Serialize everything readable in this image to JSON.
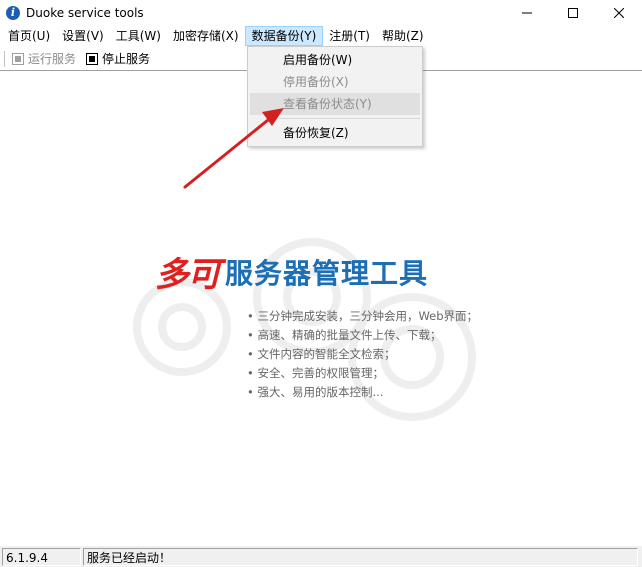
{
  "window": {
    "title": "Duoke service tools",
    "app_icon": "info-i-icon",
    "controls": [
      "minimize-icon",
      "maximize-icon",
      "close-icon"
    ]
  },
  "menubar": {
    "items": [
      {
        "label": "首页(U)"
      },
      {
        "label": "设置(V)"
      },
      {
        "label": "工具(W)"
      },
      {
        "label": "加密存储(X)"
      },
      {
        "label": "数据备份(Y)"
      },
      {
        "label": "注册(T)"
      },
      {
        "label": "帮助(Z)"
      }
    ]
  },
  "toolbar": {
    "run_label": "运行服务",
    "stop_label": "停止服务"
  },
  "dropdown": {
    "items": [
      {
        "label": "启用备份(W)"
      },
      {
        "label": "停用备份(X)"
      },
      {
        "label": "查看备份状态(Y)"
      },
      {
        "label": "备份恢复(Z)"
      }
    ]
  },
  "main": {
    "logo_red": "多可",
    "logo_blue": "服务器管理工具",
    "features": [
      "三分钟完成安装，三分钟会用，Web界面；",
      "高速、精确的批量文件上传、下载；",
      "文件内容的智能全文检索；",
      "安全、完善的权限管理；",
      "强大、易用的版本控制..."
    ]
  },
  "status": {
    "version": "6.1.9.4",
    "message": "服务已经启动！"
  },
  "colors": {
    "menu_active_bg": "#cce8ff",
    "logo_red": "#e0201e",
    "logo_blue": "#1c6fb5",
    "arrow": "#d42020"
  }
}
